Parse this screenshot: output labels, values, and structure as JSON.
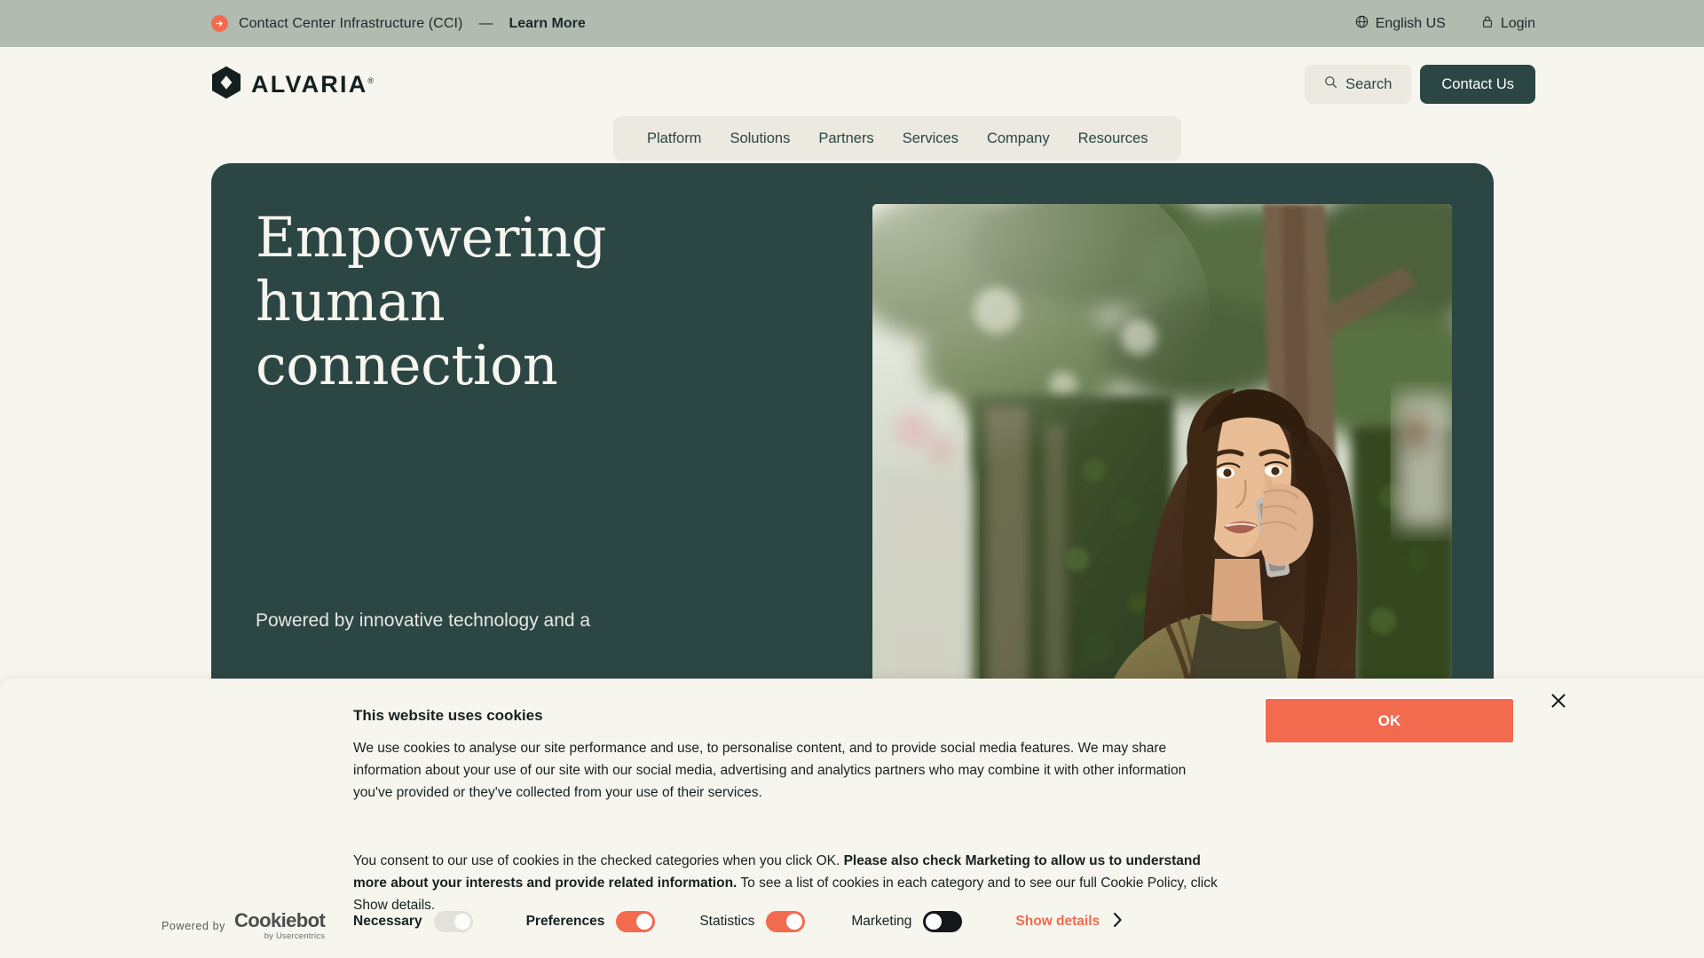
{
  "announcement": {
    "icon": "arrow-right-circle-icon",
    "text": "Contact Center Infrastructure (CCI)",
    "dash": "—",
    "link_label": "Learn More",
    "language_label": "English US",
    "language_icon": "globe-icon",
    "login_label": "Login",
    "login_icon": "lock-icon",
    "bar_color": "#B2BBB0",
    "accent_color": "#F26B4E"
  },
  "header": {
    "logo_text": "ALVARIA",
    "logo_tm": "®",
    "logo_icon": "alvaria-hexagon-logo",
    "nav": [
      {
        "label": "Platform"
      },
      {
        "label": "Solutions"
      },
      {
        "label": "Partners"
      },
      {
        "label": "Services"
      },
      {
        "label": "Company"
      },
      {
        "label": "Resources"
      }
    ],
    "search_label": "Search",
    "search_icon": "search-icon",
    "contact_label": "Contact Us",
    "brand_dark": "#2C4644",
    "page_bg": "#F6F5EE"
  },
  "hero": {
    "title": "Empowering human connection",
    "subtitle": "Powered by innovative technology and a",
    "bg_color": "#2C4644",
    "photo_alt": "Woman talking on a mobile phone outdoors beside an ivy-covered wall and tree"
  },
  "cookie_banner": {
    "title": "This website uses cookies",
    "paragraph_1": "We use cookies to analyse our site performance and use, to personalise content, and to provide social media features. We may share information about your use of our site with our social media, advertising and analytics partners who may combine it with other information you've provided or they've collected from your use of their services.",
    "paragraph_2_start": "You consent to our use of cookies in the checked categories when you click OK.",
    "paragraph_2_bold": "Please also check Marketing to allow us to understand more about your interests and provide related information.",
    "paragraph_2_end": "To see a list of cookies in each category and to see our full Cookie Policy, click Show details.",
    "ok_label": "OK",
    "close_icon": "close-icon",
    "powered_by_label": "Powered by",
    "cookiebot_name": "Cookiebot",
    "cookiebot_sub": "by Usercentrics",
    "show_details_label": "Show details",
    "show_details_icon": "chevron-right-icon",
    "ok_color": "#F26B4E",
    "toggles": [
      {
        "label": "Necessary",
        "state": "on-disabled"
      },
      {
        "label": "Preferences",
        "state": "on"
      },
      {
        "label": "Statistics",
        "state": "on"
      },
      {
        "label": "Marketing",
        "state": "off-focused"
      }
    ]
  }
}
